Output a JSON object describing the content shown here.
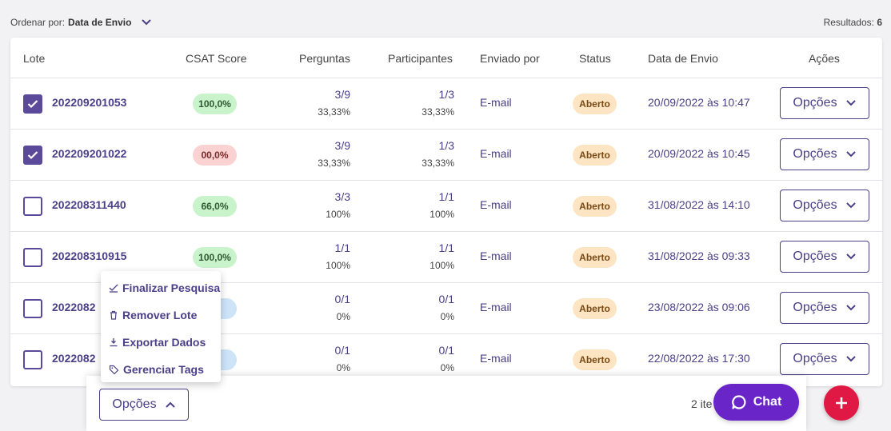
{
  "toolbar": {
    "sort_prefix": "Ordenar por:",
    "sort_value": "Data de Envio",
    "results_label": "Resultados:",
    "results_count": "6"
  },
  "table": {
    "headers": {
      "lote": "Lote",
      "csat": "CSAT Score",
      "perguntas": "Perguntas",
      "participantes": "Participantes",
      "enviado_por": "Enviado por",
      "status": "Status",
      "data_envio": "Data de Envio",
      "acoes": "Ações"
    },
    "rows": [
      {
        "lote": "202209201053",
        "csat": "100,0%",
        "perg": "3/9",
        "perg_pct": "33,33%",
        "part": "1/3",
        "part_pct": "33,33%",
        "via": "E-mail",
        "status": "Aberto",
        "date": "20/09/2022 às 10:47",
        "options": "Opções"
      },
      {
        "lote": "202209201022",
        "csat": "00,0%",
        "perg": "3/9",
        "perg_pct": "33,33%",
        "part": "1/3",
        "part_pct": "33,33%",
        "via": "E-mail",
        "status": "Aberto",
        "date": "20/09/2022 às 10:45",
        "options": "Opções"
      },
      {
        "lote": "202208311440",
        "csat": "66,0%",
        "perg": "3/3",
        "perg_pct": "100%",
        "part": "1/1",
        "part_pct": "100%",
        "via": "E-mail",
        "status": "Aberto",
        "date": "31/08/2022 às 14:10",
        "options": "Opções"
      },
      {
        "lote": "202208310915",
        "csat": "100,0%",
        "perg": "1/1",
        "perg_pct": "100%",
        "part": "1/1",
        "part_pct": "100%",
        "via": "E-mail",
        "status": "Aberto",
        "date": "31/08/2022 às 09:33",
        "options": "Opções"
      },
      {
        "lote": "2022082",
        "csat": "",
        "perg": "0/1",
        "perg_pct": "0%",
        "part": "0/1",
        "part_pct": "0%",
        "via": "E-mail",
        "status": "Aberto",
        "date": "23/08/2022 às 09:06",
        "options": "Opções"
      },
      {
        "lote": "2022082",
        "csat": "",
        "perg": "0/1",
        "perg_pct": "0%",
        "part": "0/1",
        "part_pct": "0%",
        "via": "E-mail",
        "status": "Aberto",
        "date": "22/08/2022 às 17:30",
        "options": "Opções"
      }
    ]
  },
  "dropdown_menu": {
    "items": [
      "Finalizar Pesquisa",
      "Remover Lote",
      "Exportar Dados",
      "Gerenciar Tags"
    ]
  },
  "bottom_bar": {
    "options_label": "Opções",
    "selected_text": "2 ite"
  },
  "chat": {
    "label": "Chat"
  },
  "colors": {
    "accent": "#4a3f88",
    "chat": "#6a25c8",
    "fab": "#e01844"
  }
}
